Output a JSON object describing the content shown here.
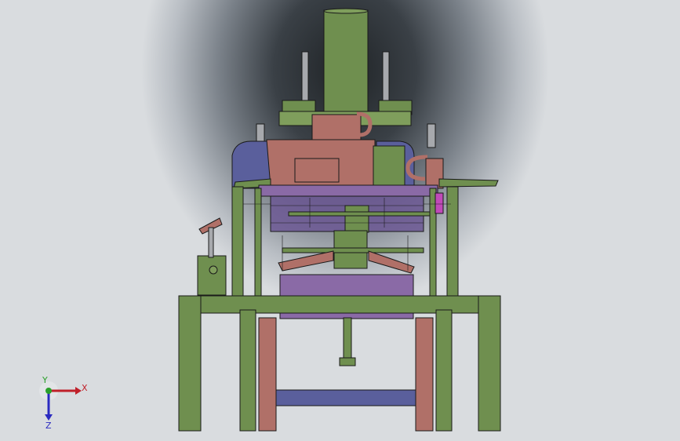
{
  "viewport": {
    "background_center": "#1f2326",
    "background_edge": "#d9dcdf"
  },
  "model": {
    "colors": {
      "green": "#6f8f4f",
      "green_light": "#7f9e5c",
      "salmon": "#b07068",
      "purple": "#8a6aa6",
      "purple_dark": "#6c5894",
      "blue": "#5a5f9c",
      "gray": "#a7a9ad",
      "outline": "#1a1a1a",
      "magenta": "#c04ab8"
    }
  },
  "triad": {
    "x_label": "X",
    "y_label": "Y",
    "z_label": "Z",
    "x_color": "#c0202a",
    "y_color": "#2aa02a",
    "z_color": "#2a2ac0",
    "icon": "coordinate-triad-icon"
  }
}
